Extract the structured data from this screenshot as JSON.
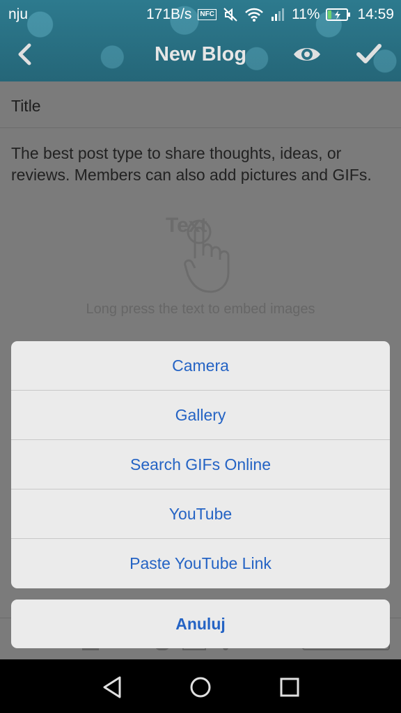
{
  "status_bar": {
    "carrier": "nju",
    "speed": "171B/s",
    "nfc_label": "NFC",
    "battery_percent": "11%",
    "time": "14:59"
  },
  "toolbar": {
    "title": "New Blog",
    "back_icon": "chevron-left-icon",
    "preview_icon": "eye-icon",
    "submit_icon": "check-icon"
  },
  "editor": {
    "title_placeholder": "Title",
    "body_placeholder": "The best post type to share thoughts, ideas, or reviews. Members can also add pictures and GIFs.",
    "embed_hint_word": "Text",
    "embed_hint_text": "Long press the text to embed images"
  },
  "sheet": {
    "items": [
      {
        "label": "Camera"
      },
      {
        "label": "Gallery"
      },
      {
        "label": "Search GIFs Online"
      },
      {
        "label": "YouTube"
      },
      {
        "label": "Paste YouTube Link"
      }
    ],
    "cancel_label": "Anuluj"
  },
  "colors": {
    "accent": "#2463c4",
    "header": "#2a7184",
    "overlay": "#7b7b7b",
    "sheet_bg": "#ebebeb"
  }
}
